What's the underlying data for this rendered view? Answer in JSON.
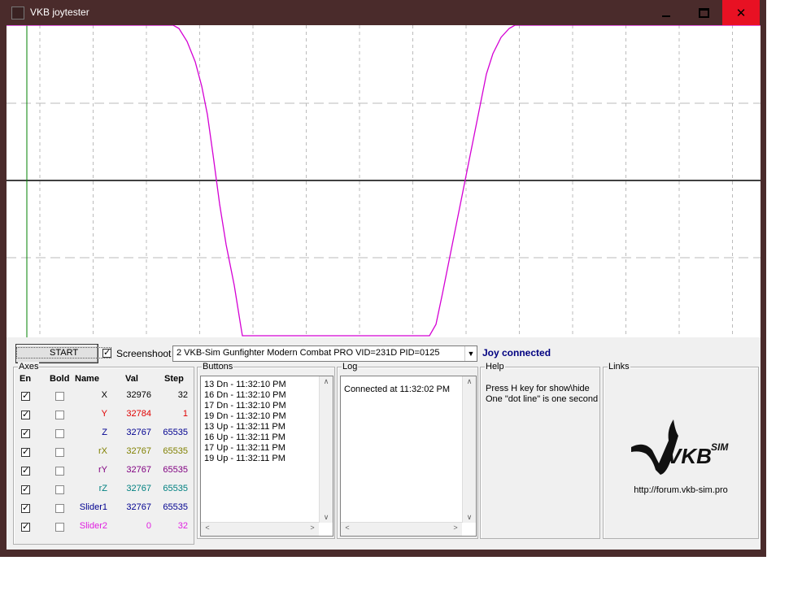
{
  "window": {
    "title": "VKB joytester"
  },
  "controls": {
    "start_label": "START",
    "screenshot_label": "Screenshoot",
    "screenshot_checked": true,
    "device_selected": "2  VKB-Sim Gunfighter Modern Combat PRO  VID=231D PID=0125",
    "status": "Joy connected"
  },
  "axes": {
    "title": "Axes",
    "headers": {
      "en": "En",
      "bold": "Bold",
      "name": "Name",
      "val": "Val",
      "step": "Step"
    },
    "rows": [
      {
        "name": "X",
        "val": "32976",
        "step": "32",
        "en": true,
        "bold": false,
        "color": "#000000"
      },
      {
        "name": "Y",
        "val": "32784",
        "step": "1",
        "en": true,
        "bold": false,
        "color": "#e00000"
      },
      {
        "name": "Z",
        "val": "32767",
        "step": "65535",
        "en": true,
        "bold": false,
        "color": "#000090"
      },
      {
        "name": "rX",
        "val": "32767",
        "step": "65535",
        "en": true,
        "bold": false,
        "color": "#808000"
      },
      {
        "name": "rY",
        "val": "32767",
        "step": "65535",
        "en": true,
        "bold": false,
        "color": "#800080"
      },
      {
        "name": "rZ",
        "val": "32767",
        "step": "65535",
        "en": true,
        "bold": false,
        "color": "#008080"
      },
      {
        "name": "Slider1",
        "val": "32767",
        "step": "65535",
        "en": true,
        "bold": false,
        "color": "#000090"
      },
      {
        "name": "Slider2",
        "val": "0",
        "step": "32",
        "en": true,
        "bold": false,
        "color": "#e020e0"
      }
    ]
  },
  "buttons": {
    "title": "Buttons",
    "lines": [
      "13 Dn - 11:32:10 PM",
      "16 Dn - 11:32:10 PM",
      "17 Dn - 11:32:10 PM",
      "19 Dn - 11:32:10 PM",
      "13 Up - 11:32:11 PM",
      "16 Up - 11:32:11 PM",
      "17 Up - 11:32:11 PM",
      "19 Up - 11:32:11 PM"
    ]
  },
  "log": {
    "title": "Log",
    "lines": [
      "Connected at 11:32:02 PM"
    ]
  },
  "help": {
    "title": "Help",
    "line1": "Press H key for show\\hide",
    "line2": "One \"dot line\" is one second"
  },
  "links": {
    "title": "Links",
    "logo_text": "VKB",
    "logo_sub": "SIM",
    "url": "http://forum.vkb-sim.pro"
  },
  "colors": {
    "trace": "#d400d4",
    "titlebar": "#4a2b2b",
    "close": "#e81123",
    "status": "#000080",
    "cursor": "#008000"
  }
}
